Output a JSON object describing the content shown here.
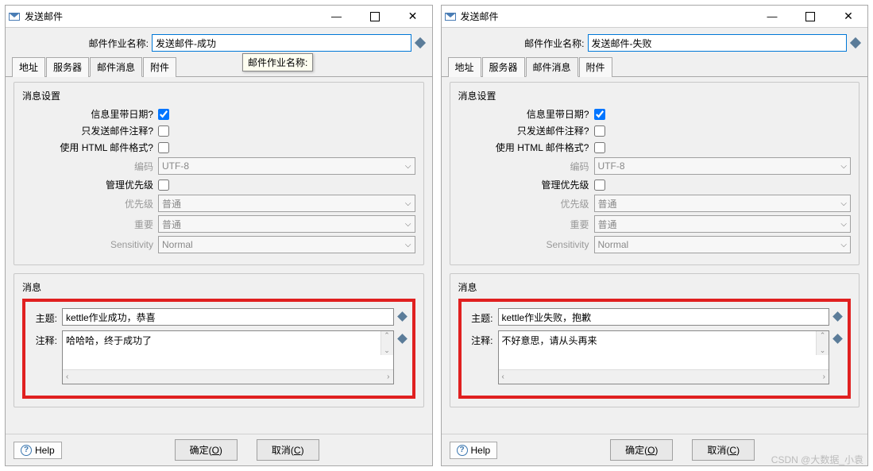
{
  "watermark": "CSDN @大数据_小袁",
  "dialogs": [
    {
      "title": "发送邮件",
      "job_name_label": "邮件作业名称:",
      "job_name_value": "发送邮件-成功",
      "tooltip": "邮件作业名称:",
      "show_tooltip": true,
      "tabs": [
        "地址",
        "服务器",
        "邮件消息",
        "附件"
      ],
      "active_tab": 2,
      "settings": {
        "group_title": "消息设置",
        "include_date_label": "信息里带日期?",
        "include_date_checked": true,
        "only_comment_label": "只发送邮件注释?",
        "only_comment_checked": false,
        "use_html_label": "使用 HTML 邮件格式?",
        "use_html_checked": false,
        "encoding_label": "编码",
        "encoding_value": "UTF-8",
        "manage_priority_label": "管理优先级",
        "manage_priority_checked": false,
        "priority_label": "优先级",
        "priority_value": "普通",
        "importance_label": "重要",
        "importance_value": "普通",
        "sensitivity_label": "Sensitivity",
        "sensitivity_value": "Normal"
      },
      "message": {
        "group_title": "消息",
        "subject_label": "主题:",
        "subject_value": "kettle作业成功，恭喜",
        "comment_label": "注释:",
        "comment_value": "哈哈哈，终于成功了"
      },
      "buttons": {
        "help": "Help",
        "ok": "确定(O)",
        "cancel": "取消(C)"
      }
    },
    {
      "title": "发送邮件",
      "job_name_label": "邮件作业名称:",
      "job_name_value": "发送邮件-失败",
      "tooltip": "",
      "show_tooltip": false,
      "tabs": [
        "地址",
        "服务器",
        "邮件消息",
        "附件"
      ],
      "active_tab": 2,
      "settings": {
        "group_title": "消息设置",
        "include_date_label": "信息里带日期?",
        "include_date_checked": true,
        "only_comment_label": "只发送邮件注释?",
        "only_comment_checked": false,
        "use_html_label": "使用 HTML 邮件格式?",
        "use_html_checked": false,
        "encoding_label": "编码",
        "encoding_value": "UTF-8",
        "manage_priority_label": "管理优先级",
        "manage_priority_checked": false,
        "priority_label": "优先级",
        "priority_value": "普通",
        "importance_label": "重要",
        "importance_value": "普通",
        "sensitivity_label": "Sensitivity",
        "sensitivity_value": "Normal"
      },
      "message": {
        "group_title": "消息",
        "subject_label": "主题:",
        "subject_value": "kettle作业失败，抱歉",
        "comment_label": "注释:",
        "comment_value": "不好意思，请从头再来"
      },
      "buttons": {
        "help": "Help",
        "ok": "确定(O)",
        "cancel": "取消(C)"
      }
    }
  ]
}
